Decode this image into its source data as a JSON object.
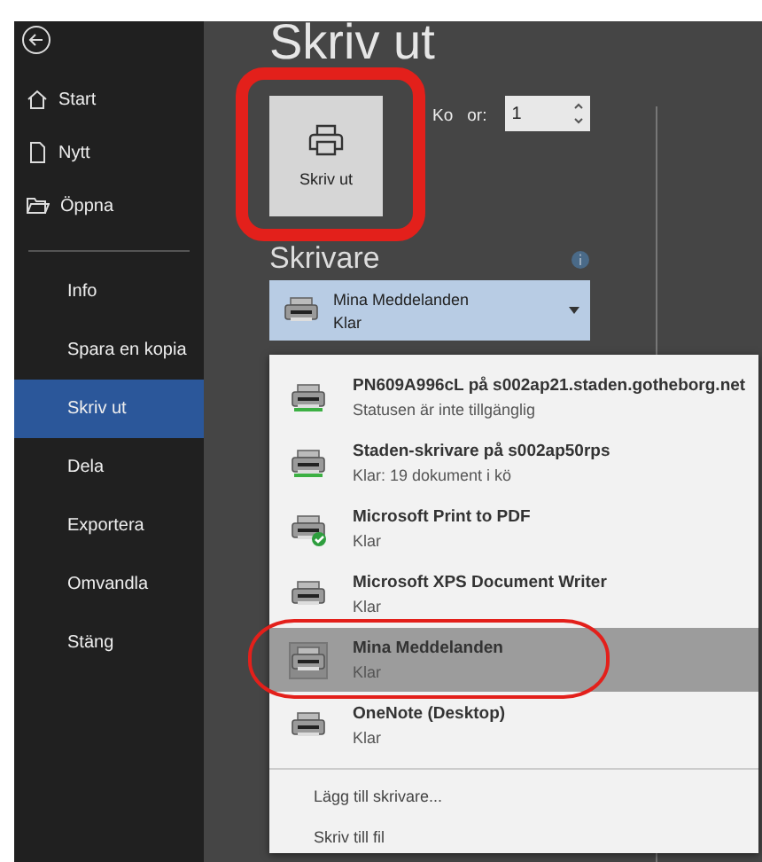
{
  "sidebar": {
    "top_items": [
      {
        "label": "Start",
        "kind": "home"
      },
      {
        "label": "Nytt",
        "kind": "document"
      },
      {
        "label": "Öppna",
        "kind": "folder"
      }
    ],
    "items": [
      {
        "label": "Info",
        "selected": false
      },
      {
        "label": "Spara en kopia",
        "selected": false
      },
      {
        "label": "Skriv ut",
        "selected": true
      },
      {
        "label": "Dela",
        "selected": false
      },
      {
        "label": "Exportera",
        "selected": false
      },
      {
        "label": "Omvandla",
        "selected": false
      },
      {
        "label": "Stäng",
        "selected": false
      }
    ]
  },
  "main": {
    "title": "Skriv ut",
    "print_button": "Skriv ut",
    "copies": {
      "label_parts": [
        "Ko",
        "or:"
      ],
      "value": "1"
    },
    "printer_heading": "Skrivare",
    "current_printer": {
      "name": "Mina Meddelanden",
      "status": "Klar"
    },
    "printer_menu": {
      "printers": [
        {
          "name": "PN609A996cL på s002ap21.staden.gotheborg.net",
          "status": "Statusen är inte tillgänglig",
          "kind": "network",
          "selected": false
        },
        {
          "name": "Staden-skrivare på s002ap50rps",
          "status": "Klar: 19 dokument i kö",
          "kind": "network",
          "selected": false
        },
        {
          "name": "Microsoft Print to PDF",
          "status": "Klar",
          "kind": "default",
          "selected": false
        },
        {
          "name": "Microsoft XPS Document Writer",
          "status": "Klar",
          "kind": "local",
          "selected": false
        },
        {
          "name": "Mina Meddelanden",
          "status": "Klar",
          "kind": "local",
          "selected": true
        },
        {
          "name": "OneNote (Desktop)",
          "status": "Klar",
          "kind": "local",
          "selected": false
        }
      ],
      "actions": [
        "Lägg till skrivare...",
        "Skriv till fil"
      ]
    }
  }
}
